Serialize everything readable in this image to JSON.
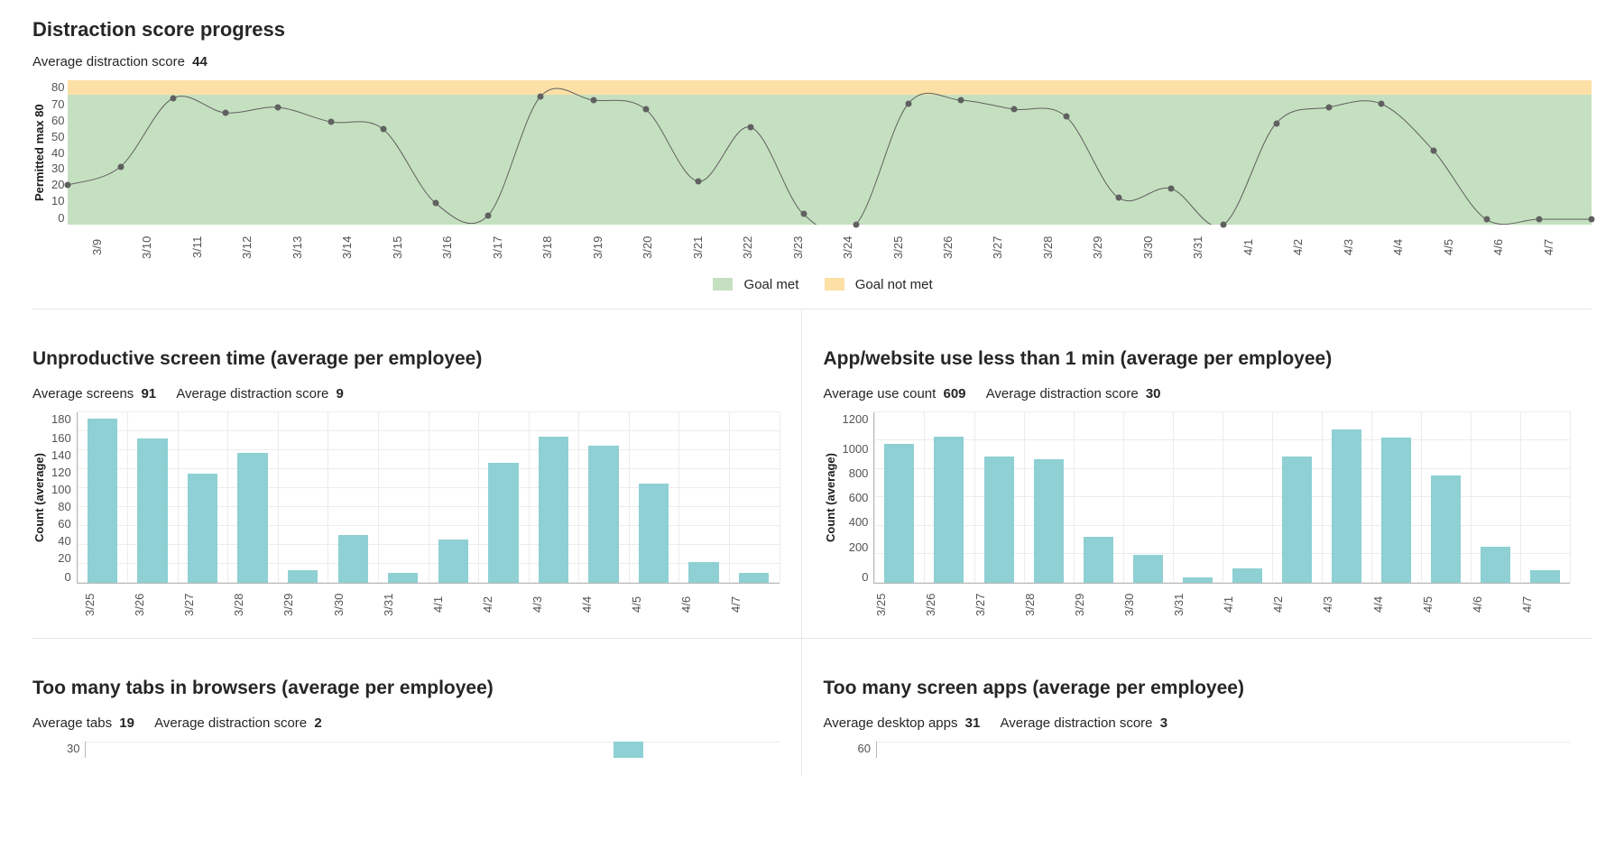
{
  "top": {
    "title": "Distraction score progress",
    "avg_label": "Average distraction score",
    "avg_value": "44",
    "ylabel": "Permitted max 80",
    "legend_met": "Goal met",
    "legend_notmet": "Goal not met"
  },
  "c1": {
    "title": "Unproductive screen time (average per employee)",
    "m1_label": "Average screens",
    "m1_value": "91",
    "m2_label": "Average distraction score",
    "m2_value": "9",
    "ylabel": "Count (average)"
  },
  "c2": {
    "title": "App/website use less than 1 min (average per employee)",
    "m1_label": "Average use count",
    "m1_value": "609",
    "m2_label": "Average distraction score",
    "m2_value": "30",
    "ylabel": "Count (average)"
  },
  "c3": {
    "title": "Too many tabs in browsers (average per employee)",
    "m1_label": "Average tabs",
    "m1_value": "19",
    "m2_label": "Average distraction score",
    "m2_value": "2"
  },
  "c4": {
    "title": "Too many screen apps (average per employee)",
    "m1_label": "Average desktop apps",
    "m1_value": "31",
    "m2_label": "Average distraction score",
    "m2_value": "3"
  },
  "chart_data": [
    {
      "id": "distraction_progress",
      "type": "line",
      "title": "Distraction score progress",
      "ylabel": "Permitted max 80",
      "ylim": [
        0,
        80
      ],
      "categories": [
        "3/9",
        "3/10",
        "3/11",
        "3/12",
        "3/13",
        "3/14",
        "3/15",
        "3/16",
        "3/17",
        "3/18",
        "3/19",
        "3/20",
        "3/21",
        "3/22",
        "3/23",
        "3/24",
        "3/25",
        "3/26",
        "3/27",
        "3/28",
        "3/29",
        "3/30",
        "3/31",
        "4/1",
        "4/2",
        "4/3",
        "4/4",
        "4/5",
        "4/6",
        "4/7"
      ],
      "values": [
        22,
        32,
        70,
        62,
        65,
        57,
        53,
        12,
        5,
        71,
        69,
        64,
        24,
        54,
        6,
        0,
        67,
        69,
        64,
        60,
        15,
        20,
        0,
        56,
        65,
        67,
        41,
        3,
        3,
        3
      ],
      "bands": [
        {
          "name": "Goal met",
          "from": 0,
          "to": 72,
          "color": "#c5e0c0"
        },
        {
          "name": "Goal not met",
          "from": 72,
          "to": 80,
          "color": "#fde0a6"
        }
      ]
    },
    {
      "id": "unproductive_screen_time",
      "type": "bar",
      "title": "Unproductive screen time (average per employee)",
      "ylabel": "Count (average)",
      "ylim": [
        0,
        180
      ],
      "ystep": 20,
      "categories": [
        "3/25",
        "3/26",
        "3/27",
        "3/28",
        "3/29",
        "3/30",
        "3/31",
        "4/1",
        "4/2",
        "4/3",
        "4/4",
        "4/5",
        "4/6",
        "4/7"
      ],
      "values": [
        173,
        152,
        115,
        137,
        13,
        50,
        10,
        46,
        127,
        154,
        145,
        105,
        22,
        10
      ]
    },
    {
      "id": "app_use_lt_1min",
      "type": "bar",
      "title": "App/website use less than 1 min (average per employee)",
      "ylabel": "Count (average)",
      "ylim": [
        0,
        1200
      ],
      "ystep": 200,
      "categories": [
        "3/25",
        "3/26",
        "3/27",
        "3/28",
        "3/29",
        "3/30",
        "3/31",
        "4/1",
        "4/2",
        "4/3",
        "4/4",
        "4/5",
        "4/6",
        "4/7"
      ],
      "values": [
        975,
        1030,
        890,
        870,
        325,
        195,
        40,
        100,
        890,
        1080,
        1020,
        755,
        250,
        85
      ]
    },
    {
      "id": "too_many_tabs",
      "type": "bar",
      "title": "Too many tabs in browsers (average per employee)",
      "ylim": [
        0,
        30
      ],
      "categories": [],
      "values": []
    },
    {
      "id": "too_many_screen_apps",
      "type": "bar",
      "title": "Too many screen apps (average per employee)",
      "ylim": [
        0,
        60
      ],
      "categories": [],
      "values": []
    }
  ]
}
